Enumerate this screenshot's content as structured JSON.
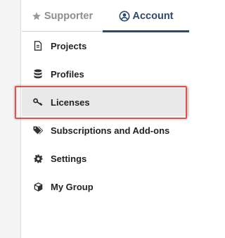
{
  "tabs": [
    {
      "label": "Supporter",
      "icon": "star-icon",
      "active": false
    },
    {
      "label": "Account",
      "icon": "user-circle-icon",
      "active": true
    }
  ],
  "menu": [
    {
      "label": "Projects",
      "icon": "document-icon"
    },
    {
      "label": "Profiles",
      "icon": "database-icon"
    },
    {
      "label": "Licenses",
      "icon": "key-icon",
      "active": true
    },
    {
      "label": "Subscriptions and Add-ons",
      "icon": "tags-icon"
    },
    {
      "label": "Settings",
      "icon": "gear-icon"
    },
    {
      "label": "My Group",
      "icon": "cube-icon"
    }
  ],
  "colors": {
    "accent": "#2e4a6b",
    "inactive_tab": "#8e8e8e",
    "highlight": "#e4504a",
    "active_row": "#e9e9e9"
  }
}
